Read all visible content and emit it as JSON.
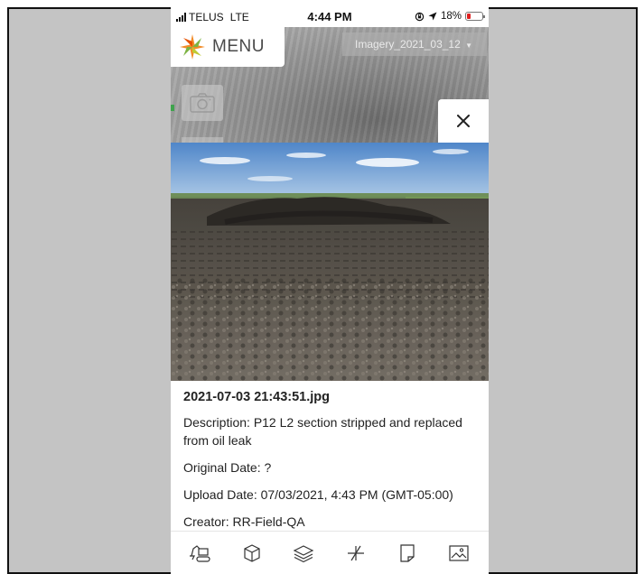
{
  "status_bar": {
    "carrier": "TELUS",
    "network": "LTE",
    "time": "4:44 PM",
    "battery": "18%",
    "battery_color": "#e02020"
  },
  "map": {
    "menu_label": "MENU",
    "imagery_select": "Imagery_2021_03_12",
    "camera_icon": "camera-icon",
    "close_icon": "close-icon"
  },
  "photo": {
    "description": "Photo of stripped soil field with tire tracks and dirt pile under blue sky"
  },
  "info": {
    "file_name": "2021-07-03 21:43:51.jpg",
    "description_key": "Description",
    "description_value": "P12 L2 section stripped and replaced from oil leak",
    "original_date_key": "Original Date",
    "original_date_value": "?",
    "upload_date_key": "Upload Date",
    "upload_date_value": "07/03/2021, 4:43 PM (GMT-05:00)",
    "creator_key": "Creator",
    "creator_value": "RR-Field-QA"
  },
  "toolbar": {
    "icons": [
      "excavator-icon",
      "cube-icon",
      "layers-icon",
      "measure-icon",
      "note-icon",
      "image-icon"
    ]
  },
  "colors": {
    "background": "#c4c4c4",
    "logo_orange": "#f28c28",
    "logo_green": "#7cb342",
    "text_dark": "#222222"
  }
}
